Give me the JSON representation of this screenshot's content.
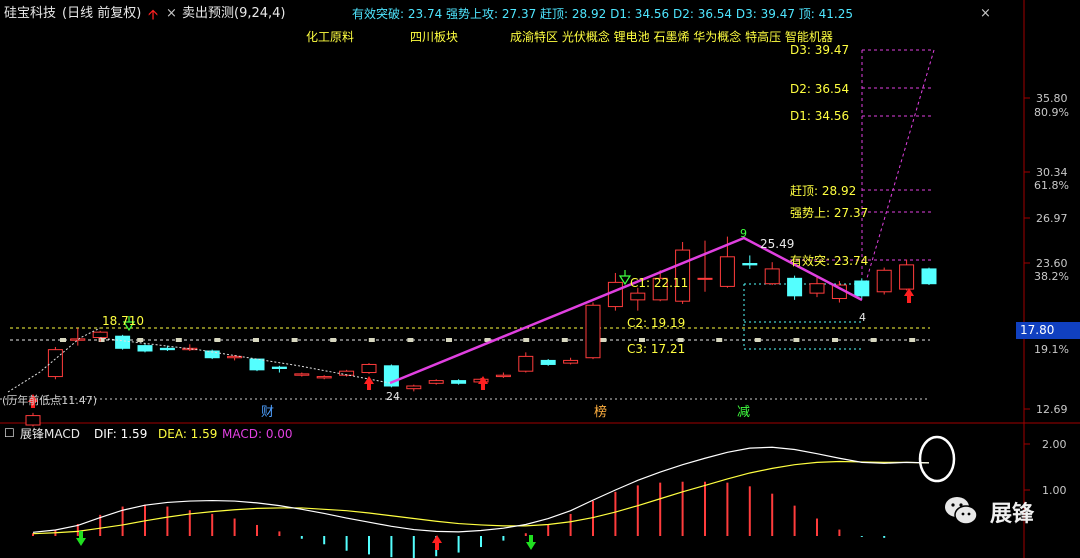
{
  "header": {
    "stock_name": "硅宝科技",
    "period_mode": "(日线 前复权)",
    "indicator_name": "卖出预测(9,24,4)",
    "breakout_stats": "有效突破: 23.74  强势上攻: 27.37  赶顶: 28.92  D1: 34.56  D2: 36.54  D3: 39.47  顶: 41.25",
    "concepts_1": "化工原料",
    "concepts_2": "四川板块",
    "concepts_3": "成渝特区 光伏概念 锂电池 石墨烯 华为概念 特高压 智能机器",
    "close_label": "×",
    "close_label_2": "×"
  },
  "price_axis": {
    "labels": [
      "35.80",
      "80.9%",
      "30.34",
      "61.8%",
      "26.97",
      "23.60",
      "38.2%",
      "17.80",
      "19.1%",
      "12.69"
    ],
    "current_price": "17.80"
  },
  "annotations": {
    "level_d3": "D3: 39.47",
    "level_d2": "D2: 36.54",
    "level_d1": "D1: 34.56",
    "level_top": "赶顶: 28.92",
    "level_strong": "强势上: 27.37",
    "level_break": "有效突: 23.74",
    "peak_label": "25.49",
    "peak_count": "9",
    "low_label": "24",
    "low_count": "4",
    "c1": "C1: 22.11",
    "c2": "C2: 19.19",
    "c3": "C3: 17.21",
    "left_high": "18.710",
    "left_bottom": "(历年前低点11.47)",
    "marker_cai": "财",
    "marker_bang": "榜",
    "marker_jian": "减"
  },
  "macd": {
    "name": "展锋MACD",
    "dif": "DIF: 1.59",
    "dea": "DEA: 1.59",
    "macd": "MACD: 0.00",
    "axis": [
      "2.00",
      "1.00"
    ]
  },
  "watermark": {
    "text": "展锋"
  },
  "colors": {
    "up": "#ff3c3c",
    "down": "#54ffff",
    "trend": "#e040e0",
    "yellow": "#ffff40",
    "white": "#ffffff",
    "axis": "#a00000"
  },
  "chart_data": [
    {
      "type": "candlestick",
      "title": "",
      "candles": [
        {
          "o": 11.5,
          "c": 12.2,
          "h": 12.4,
          "l": 11.4
        },
        {
          "o": 15.1,
          "c": 17.1,
          "h": 17.3,
          "l": 14.9
        },
        {
          "o": 17.8,
          "c": 17.9,
          "h": 18.7,
          "l": 17.4
        },
        {
          "o": 18.0,
          "c": 18.4,
          "h": 18.5,
          "l": 17.7
        },
        {
          "o": 18.1,
          "c": 17.2,
          "h": 18.2,
          "l": 17.1
        },
        {
          "o": 17.4,
          "c": 17.0,
          "h": 17.6,
          "l": 16.9
        },
        {
          "o": 17.2,
          "c": 17.1,
          "h": 17.4,
          "l": 17.0
        },
        {
          "o": 17.1,
          "c": 17.2,
          "h": 17.5,
          "l": 17.0
        },
        {
          "o": 17.0,
          "c": 16.5,
          "h": 17.1,
          "l": 16.4
        },
        {
          "o": 16.5,
          "c": 16.6,
          "h": 16.7,
          "l": 16.3
        },
        {
          "o": 16.4,
          "c": 15.6,
          "h": 16.4,
          "l": 15.5
        },
        {
          "o": 15.8,
          "c": 15.7,
          "h": 15.9,
          "l": 15.4
        },
        {
          "o": 15.2,
          "c": 15.3,
          "h": 15.4,
          "l": 15.1
        },
        {
          "o": 15.0,
          "c": 15.1,
          "h": 15.2,
          "l": 14.9
        },
        {
          "o": 15.2,
          "c": 15.5,
          "h": 15.6,
          "l": 15.1
        },
        {
          "o": 15.4,
          "c": 16.0,
          "h": 16.1,
          "l": 15.3
        },
        {
          "o": 15.9,
          "c": 14.4,
          "h": 16.0,
          "l": 14.3
        },
        {
          "o": 14.2,
          "c": 14.4,
          "h": 14.5,
          "l": 14.0
        },
        {
          "o": 14.6,
          "c": 14.8,
          "h": 14.9,
          "l": 14.5
        },
        {
          "o": 14.8,
          "c": 14.6,
          "h": 14.9,
          "l": 14.5
        },
        {
          "o": 14.7,
          "c": 14.9,
          "h": 15.0,
          "l": 14.6
        },
        {
          "o": 15.1,
          "c": 15.2,
          "h": 15.4,
          "l": 15.0
        },
        {
          "o": 15.5,
          "c": 16.6,
          "h": 16.9,
          "l": 15.4
        },
        {
          "o": 16.3,
          "c": 16.0,
          "h": 16.4,
          "l": 15.9
        },
        {
          "o": 16.1,
          "c": 16.3,
          "h": 16.5,
          "l": 16.0
        },
        {
          "o": 16.5,
          "c": 20.4,
          "h": 20.6,
          "l": 16.4
        },
        {
          "o": 20.3,
          "c": 22.1,
          "h": 22.8,
          "l": 20.0
        },
        {
          "o": 20.8,
          "c": 21.3,
          "h": 21.7,
          "l": 20.0
        },
        {
          "o": 20.8,
          "c": 22.4,
          "h": 23.0,
          "l": 20.7
        },
        {
          "o": 20.7,
          "c": 24.5,
          "h": 25.1,
          "l": 20.5
        },
        {
          "o": 22.4,
          "c": 22.4,
          "h": 25.2,
          "l": 21.4
        },
        {
          "o": 21.8,
          "c": 24.0,
          "h": 25.5,
          "l": 21.7
        },
        {
          "o": 23.5,
          "c": 23.4,
          "h": 24.1,
          "l": 23.1
        },
        {
          "o": 22.0,
          "c": 23.1,
          "h": 23.6,
          "l": 21.9
        },
        {
          "o": 22.4,
          "c": 21.1,
          "h": 22.6,
          "l": 20.8
        },
        {
          "o": 21.3,
          "c": 22.0,
          "h": 22.6,
          "l": 21.0
        },
        {
          "o": 20.9,
          "c": 21.9,
          "h": 22.2,
          "l": 20.6
        },
        {
          "o": 22.2,
          "c": 21.1,
          "h": 22.4,
          "l": 20.9
        },
        {
          "o": 21.4,
          "c": 23.0,
          "h": 23.2,
          "l": 21.2
        },
        {
          "o": 21.6,
          "c": 23.4,
          "h": 23.8,
          "l": 21.5
        },
        {
          "o": 23.1,
          "c": 22.0,
          "h": 23.2,
          "l": 21.9
        }
      ],
      "levels": [
        23.74,
        27.37,
        28.92,
        34.56,
        36.54,
        39.47
      ],
      "ylim": [
        12.2,
        43
      ]
    },
    {
      "type": "bar",
      "title": "展锋MACD",
      "series": [
        {
          "name": "DIF",
          "values": [
            0.08,
            0.13,
            0.23,
            0.4,
            0.56,
            0.67,
            0.73,
            0.76,
            0.77,
            0.76,
            0.72,
            0.66,
            0.58,
            0.49,
            0.39,
            0.3,
            0.21,
            0.14,
            0.1,
            0.09,
            0.12,
            0.17,
            0.25,
            0.38,
            0.55,
            0.78,
            1.0,
            1.21,
            1.39,
            1.55,
            1.69,
            1.82,
            1.91,
            1.93,
            1.88,
            1.79,
            1.69,
            1.6,
            1.58,
            1.6,
            1.59
          ]
        },
        {
          "name": "DEA",
          "values": [
            0.05,
            0.07,
            0.1,
            0.17,
            0.24,
            0.33,
            0.41,
            0.48,
            0.53,
            0.57,
            0.6,
            0.61,
            0.61,
            0.58,
            0.55,
            0.5,
            0.44,
            0.38,
            0.32,
            0.27,
            0.24,
            0.22,
            0.22,
            0.25,
            0.31,
            0.4,
            0.52,
            0.66,
            0.81,
            0.96,
            1.1,
            1.24,
            1.37,
            1.47,
            1.55,
            1.6,
            1.62,
            1.61,
            1.6,
            1.6,
            1.59
          ]
        },
        {
          "name": "MACD",
          "values": [
            0.06,
            0.12,
            0.26,
            0.46,
            0.64,
            0.68,
            0.64,
            0.56,
            0.48,
            0.38,
            0.24,
            0.1,
            -0.06,
            -0.18,
            -0.32,
            -0.4,
            -0.46,
            -0.48,
            -0.44,
            -0.36,
            -0.24,
            -0.1,
            0.06,
            0.26,
            0.48,
            0.76,
            0.96,
            1.1,
            1.16,
            1.18,
            1.18,
            1.16,
            1.08,
            0.92,
            0.66,
            0.38,
            0.14,
            -0.02,
            -0.04,
            0.0,
            0.0
          ]
        }
      ],
      "ylim": [
        -0.6,
        2.4
      ]
    }
  ]
}
